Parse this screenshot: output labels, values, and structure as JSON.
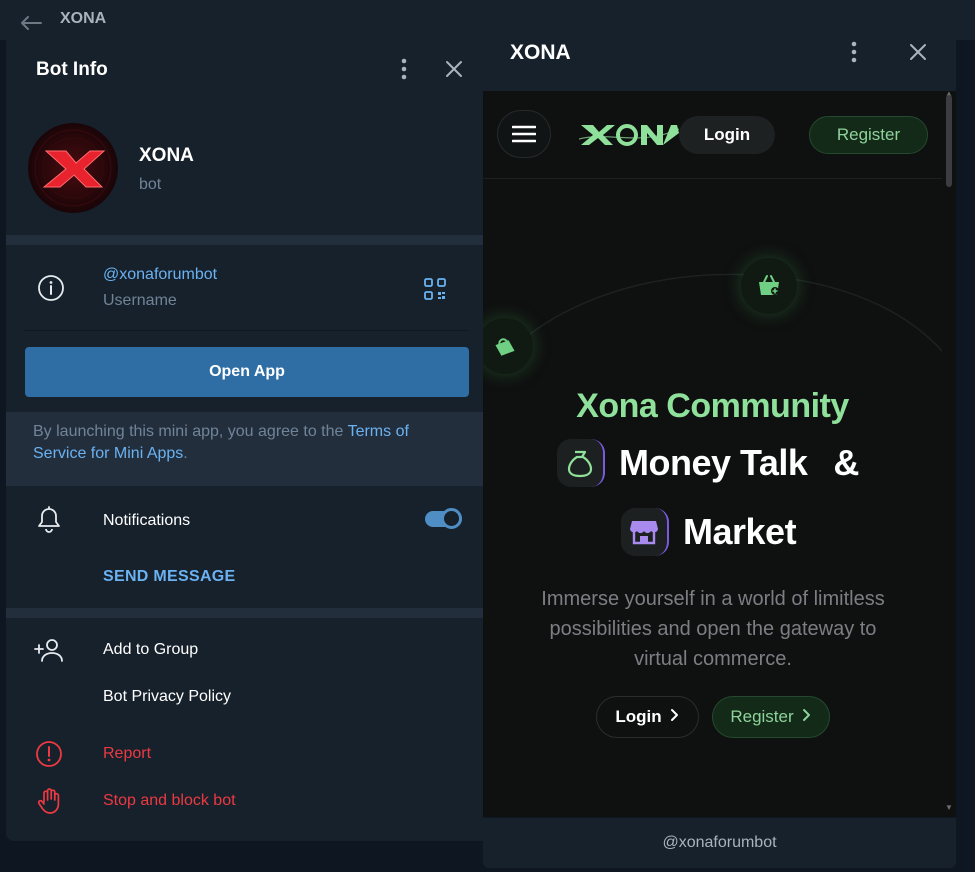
{
  "background_chat": {
    "title": "XONA",
    "back_icon": "arrow-left-icon"
  },
  "bot_info": {
    "title": "Bot Info",
    "more_icon": "more-vertical-icon",
    "close_icon": "close-icon",
    "profile": {
      "name": "XONA",
      "subtitle": "bot"
    },
    "username": {
      "value": "@xonaforumbot",
      "label": "Username",
      "icon": "info-icon",
      "qr_icon": "qr-code-icon"
    },
    "open_app_label": "Open App",
    "terms": {
      "prefix": "By launching this mini app, you agree to the ",
      "link": "Terms of Service for Mini Apps",
      "suffix": "."
    },
    "notifications": {
      "label": "Notifications",
      "enabled": true,
      "icon": "bell-icon"
    },
    "send_message_label": "SEND MESSAGE",
    "actions": [
      {
        "label": "Add to Group",
        "icon": "add-user-icon"
      },
      {
        "label": "Bot Privacy Policy",
        "icon": ""
      },
      {
        "label": "Report",
        "icon": "alert-circle-icon"
      },
      {
        "label": "Stop and block bot",
        "icon": "hand-stop-icon"
      }
    ],
    "colors": {
      "accent": "#6ab2f2",
      "button": "#2f6ea5",
      "danger": "#ec3942",
      "panel": "#17212b"
    }
  },
  "mini_app": {
    "title": "XONA",
    "more_icon": "more-vertical-icon",
    "close_icon": "close-icon",
    "nav": {
      "menu_icon": "hamburger-menu-icon",
      "logo": "XONA",
      "login_label": "Login",
      "register_label": "Register"
    },
    "hero": {
      "title": "Xona Community",
      "line2_word": "Money Talk",
      "ampersand": "&",
      "line3_word": "Market",
      "line2_icon": "money-bag-icon",
      "line3_icon": "storefront-icon",
      "description": "Immerse yourself in a world of limitless possibilities and open the gateway to virtual commerce.",
      "login_label": "Login",
      "register_label": "Register"
    },
    "footer": "@xonaforumbot",
    "colors": {
      "green": "#8ee09a",
      "purple": "#a98bf0",
      "page_bg": "#0f1010"
    }
  }
}
